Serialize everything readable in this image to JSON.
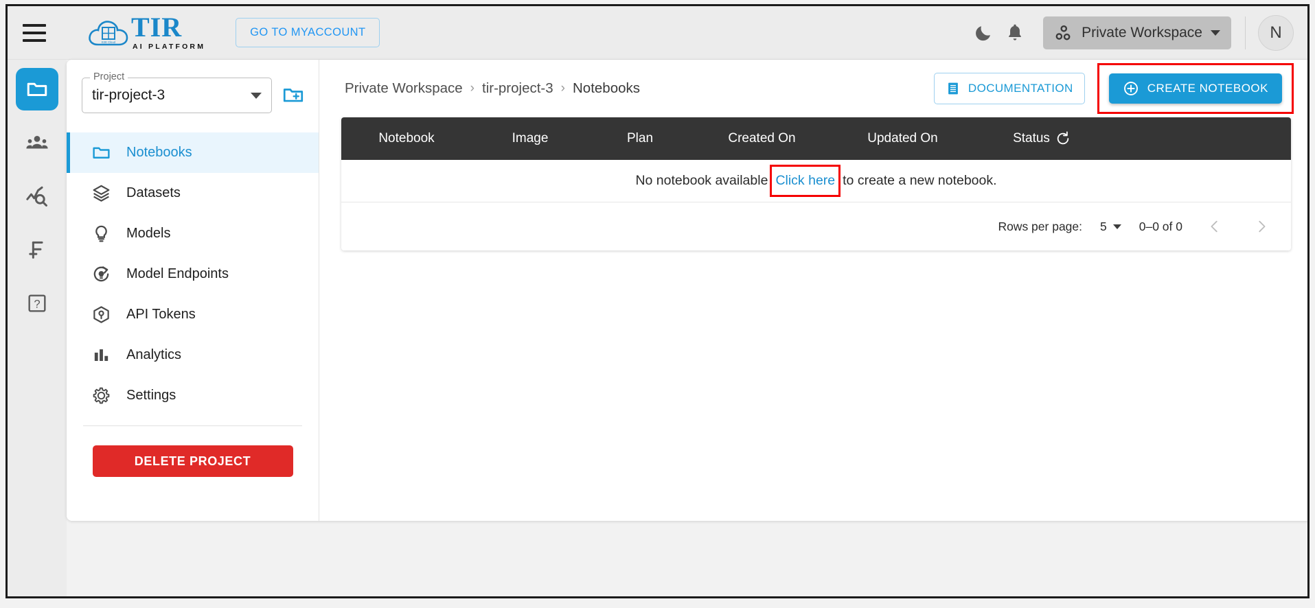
{
  "topbar": {
    "menu_icon": "hamburger-icon",
    "logo_title": "TIR",
    "logo_subtitle": "AI PLATFORM",
    "myaccount_label": "GO TO MYACCOUNT",
    "dark_mode_icon": "moon-icon",
    "notifications_icon": "bell-icon",
    "workspace_label": "Private Workspace",
    "workspace_icon": "workspace-dots-icon",
    "avatar_initial": "N"
  },
  "rail": {
    "items": [
      {
        "icon": "folder-icon",
        "name": "projects",
        "active": true
      },
      {
        "icon": "team-icon",
        "name": "team",
        "active": false
      },
      {
        "icon": "monitoring-icon",
        "name": "monitoring",
        "active": false
      },
      {
        "icon": "billing-icon",
        "name": "billing",
        "active": false
      },
      {
        "icon": "help-icon",
        "name": "help",
        "active": false
      }
    ]
  },
  "project_panel": {
    "select_legend": "Project",
    "select_value": "tir-project-3",
    "new_project_icon": "new-folder-icon",
    "menu": [
      {
        "label": "Notebooks",
        "icon": "folder-icon",
        "active": true
      },
      {
        "label": "Datasets",
        "icon": "layers-icon",
        "active": false
      },
      {
        "label": "Models",
        "icon": "bulb-icon",
        "active": false
      },
      {
        "label": "Model Endpoints",
        "icon": "deploy-icon",
        "active": false
      },
      {
        "label": "API Tokens",
        "icon": "cube-key-icon",
        "active": false
      },
      {
        "label": "Analytics",
        "icon": "bar-chart-icon",
        "active": false
      },
      {
        "label": "Settings",
        "icon": "gear-icon",
        "active": false
      }
    ],
    "delete_label": "DELETE PROJECT"
  },
  "breadcrumb": {
    "items": [
      "Private Workspace",
      "tir-project-3",
      "Notebooks"
    ],
    "separator": "›"
  },
  "actions": {
    "documentation_label": "DOCUMENTATION",
    "documentation_icon": "document-icon",
    "create_label": "CREATE NOTEBOOK",
    "create_icon": "plus-circle-icon"
  },
  "table": {
    "columns": [
      "Notebook",
      "Image",
      "Plan",
      "Created On",
      "Updated On",
      "Status"
    ],
    "refresh_icon": "refresh-icon",
    "empty_prefix": "No notebook available",
    "empty_link": "Click here",
    "empty_suffix": "to create a new notebook.",
    "rows": []
  },
  "pagination": {
    "rows_per_page_label": "Rows per page:",
    "rows_per_page_value": "5",
    "range_label": "0–0 of 0",
    "prev_icon": "chevron-left-icon",
    "next_icon": "chevron-right-icon"
  },
  "colors": {
    "accent": "#1b9ad6",
    "highlight": "#f50000",
    "danger": "#e02a28",
    "header_dark": "#353535",
    "topbar_bg": "#ececec"
  }
}
